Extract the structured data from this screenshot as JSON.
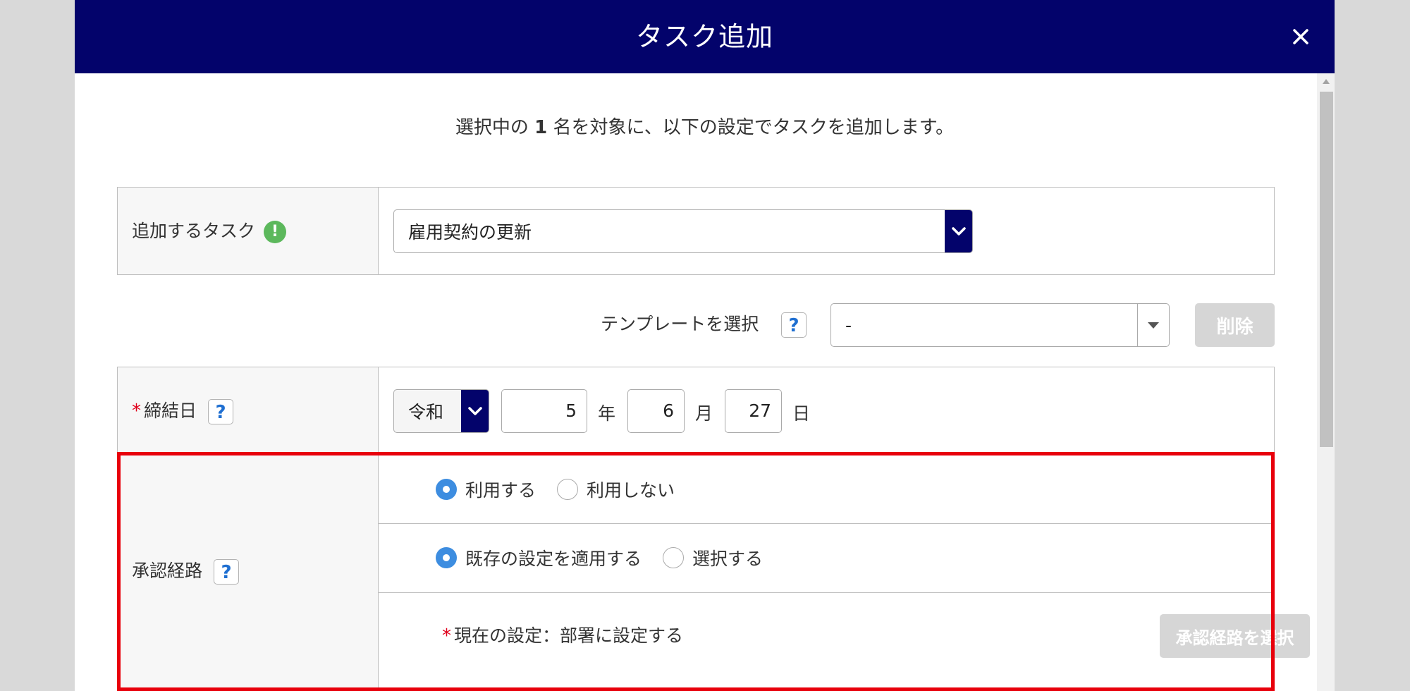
{
  "modal": {
    "title": "タスク追加",
    "close_glyph": "×"
  },
  "intro": {
    "prefix": "選択中の ",
    "count": "1",
    "suffix": " 名を対象に、以下の設定でタスクを追加します。"
  },
  "task_row": {
    "label": "追加するタスク",
    "info_glyph": "!",
    "selected": "雇用契約の更新"
  },
  "template_row": {
    "label": "テンプレートを選択",
    "help": "?",
    "selected": "-",
    "delete_label": "削除"
  },
  "date_row": {
    "required_mark": "*",
    "label": "締結日",
    "help": "?",
    "era": "令和",
    "year_value": "5",
    "year_unit": "年",
    "month_value": "6",
    "month_unit": "月",
    "day_value": "27",
    "day_unit": "日"
  },
  "approval_row": {
    "label": "承認経路",
    "help": "?",
    "use_options": [
      {
        "label": "利用する",
        "selected": true
      },
      {
        "label": "利用しない",
        "selected": false
      }
    ],
    "mode_options": [
      {
        "label": "既存の設定を適用する",
        "selected": true
      },
      {
        "label": "選択する",
        "selected": false
      }
    ],
    "required_mark": "*",
    "current_setting": "現在の設定：部署に設定する",
    "select_button": "承認経路を選択"
  },
  "colors": {
    "header": "#03036b",
    "highlight_frame": "#e8000b",
    "radio_selected": "#3d8de0",
    "info_green": "#5cb85c",
    "disabled_button": "#d6d6d6"
  }
}
